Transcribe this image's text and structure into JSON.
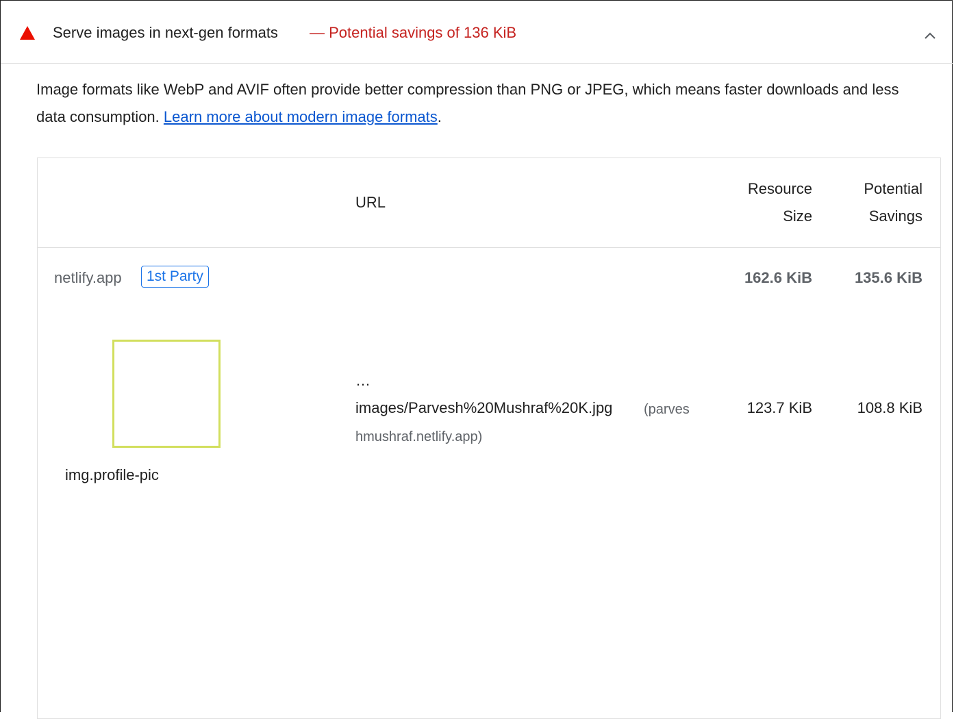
{
  "audit": {
    "title": "Serve images in next-gen formats",
    "savings": "— Potential savings of 136 KiB",
    "description": "Image formats like WebP and AVIF often provide better compression than PNG or JPEG, which means faster downloads and less data consumption. ",
    "link_text": "Learn more about modern image formats",
    "description_end": "."
  },
  "table": {
    "headers": {
      "url": "URL",
      "resource_size_line1": "Resource",
      "resource_size_line2": "Size",
      "potential_savings_line1": "Potential",
      "potential_savings_line2": "Savings"
    },
    "group": {
      "entity": "netlify.app",
      "badge": "1st Party",
      "resource_size": "162.6 KiB",
      "potential_savings": "135.6 KiB"
    },
    "items": [
      {
        "node_label": "img.profile-pic",
        "url_prefix": "…",
        "url_path": "images/Parvesh%20Mushraf%20K.jpg",
        "url_host_part1": "(parves",
        "url_host_part2": "hmushraf.netlify.app)",
        "resource_size": "123.7 KiB",
        "potential_savings": "108.8 KiB"
      }
    ]
  },
  "colors": {
    "warning": "#eb0f00",
    "savings_text": "#c5221f",
    "link": "#0b57d0",
    "badge": "#1a73e8",
    "thumbnail_border": "#d2df5e"
  },
  "icons": {
    "warning": "warning-triangle-icon",
    "collapse": "chevron-up-icon"
  }
}
